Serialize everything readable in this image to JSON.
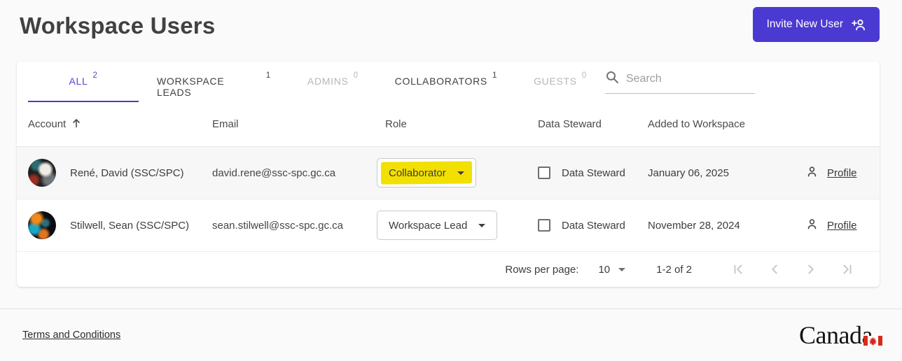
{
  "colors": {
    "accent": "#4B3AD2",
    "highlight": "#F2E003",
    "page_background": "#FAFAFA",
    "flag_red": "#D52B1E"
  },
  "header": {
    "title": "Workspace Users",
    "invite_button_label": "Invite New User"
  },
  "tabs": [
    {
      "label": "ALL",
      "count": "2",
      "state": "active"
    },
    {
      "label": "WORKSPACE LEADS",
      "count": "1",
      "state": "enabled"
    },
    {
      "label": "ADMINS",
      "count": "0",
      "state": "disabled"
    },
    {
      "label": "COLLABORATORS",
      "count": "1",
      "state": "enabled"
    },
    {
      "label": "GUESTS",
      "count": "0",
      "state": "disabled"
    }
  ],
  "search": {
    "placeholder": "Search"
  },
  "table": {
    "columns": [
      "Account",
      "Email",
      "Role",
      "Data Steward",
      "Added to Workspace"
    ],
    "sort_column": "Account",
    "sort_direction": "ascending",
    "rows": [
      {
        "name": "René, David (SSC/SPC)",
        "email": "david.rene@ssc-spc.gc.ca",
        "role": "Collaborator",
        "role_highlighted": true,
        "steward_label": "Data Steward",
        "steward_checked": false,
        "added": "January 06, 2025",
        "profile_label": "Profile"
      },
      {
        "name": "Stilwell, Sean (SSC/SPC)",
        "email": "sean.stilwell@ssc-spc.gc.ca",
        "role": "Workspace Lead",
        "role_highlighted": false,
        "steward_label": "Data Steward",
        "steward_checked": false,
        "added": "November 28, 2024",
        "profile_label": "Profile"
      }
    ]
  },
  "pagination": {
    "rows_per_page_label": "Rows per page:",
    "rows_per_page_value": "10",
    "range_label": "1-2 of 2"
  },
  "footer": {
    "terms_label": "Terms and Conditions",
    "wordmark": "Canada"
  }
}
